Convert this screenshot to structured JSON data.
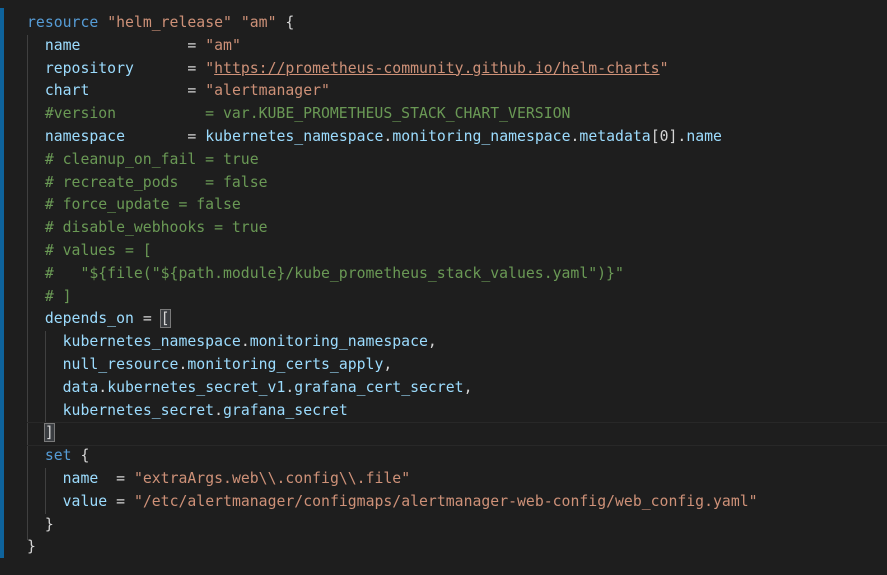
{
  "editor": {
    "lines": [
      "resource \"helm_release\" \"am\" {",
      "  name            = \"am\"",
      "  repository      = \"https://prometheus-community.github.io/helm-charts\"",
      "  chart           = \"alertmanager\"",
      "  #version          = var.KUBE_PROMETHEUS_STACK_CHART_VERSION",
      "  namespace       = kubernetes_namespace.monitoring_namespace.metadata[0].name",
      "  # cleanup_on_fail = true",
      "  # recreate_pods   = false",
      "  # force_update = false",
      "  # disable_webhooks = true",
      "  # values = [",
      "  #   \"${file(\"${path.module}/kube_prometheus_stack_values.yaml\")}\"",
      "  # ]",
      "  depends_on = [",
      "    kubernetes_namespace.monitoring_namespace,",
      "    null_resource.monitoring_certs_apply,",
      "    data.kubernetes_secret_v1.grafana_cert_secret,",
      "    kubernetes_secret.grafana_secret",
      "  ]",
      "  set {",
      "    name  = \"extraArgs.web\\\\.config\\\\.file\"",
      "    value = \"/etc/alertmanager/configmaps/alertmanager-web-config/web_config.yaml\"",
      "  }",
      "}"
    ]
  }
}
